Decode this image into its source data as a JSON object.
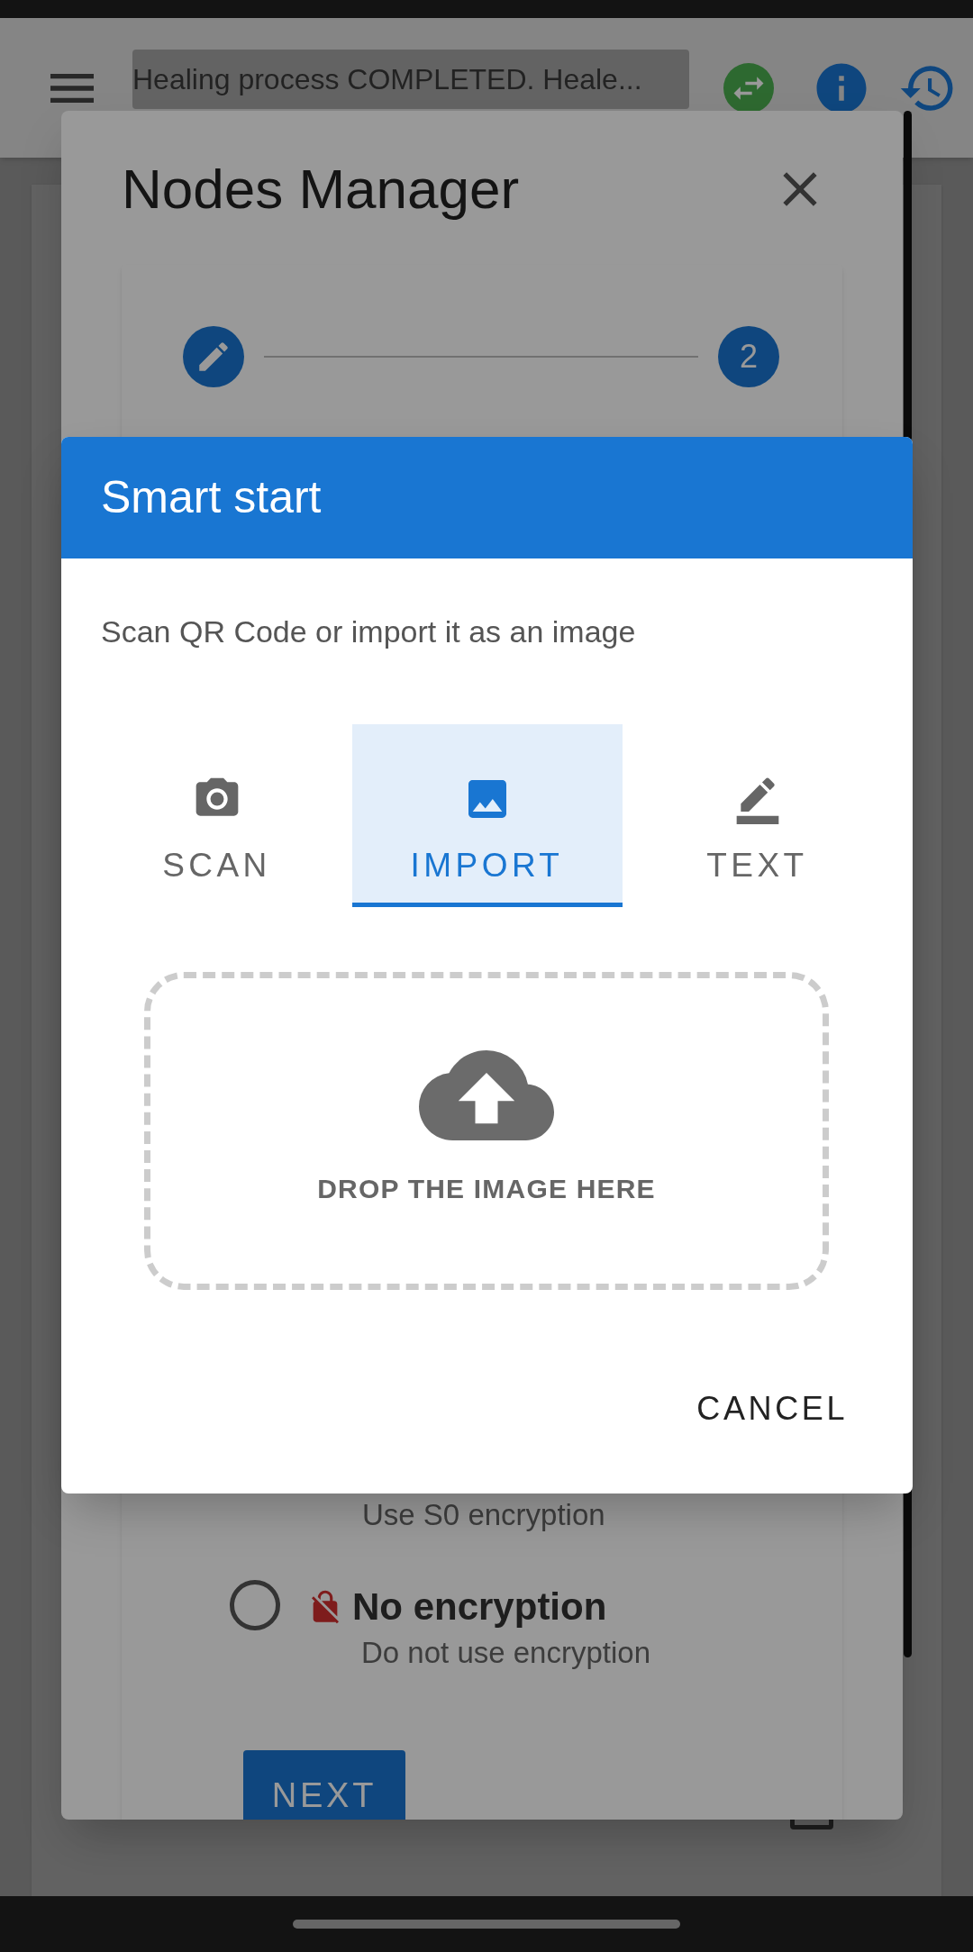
{
  "app_bar": {
    "status_text": "Healing process COMPLETED. Heale..."
  },
  "page": {
    "checkbox": {
      "checked": false
    }
  },
  "nodes_manager": {
    "title": "Nodes Manager",
    "steps": [
      {
        "kind": "edit"
      },
      {
        "kind": "number",
        "label": "2"
      }
    ],
    "security_options": [
      {
        "kind": "partial",
        "description": "Use S0 encryption"
      },
      {
        "kind": "full",
        "title": "No encryption",
        "description": "Do not use encryption",
        "selected": false
      }
    ],
    "next_button": "NEXT"
  },
  "smart_start": {
    "title": "Smart start",
    "instructions": "Scan QR Code or import it as an image",
    "tabs": [
      {
        "label": "SCAN",
        "kind": "camera",
        "selected": false
      },
      {
        "label": "IMPORT",
        "kind": "image",
        "selected": true
      },
      {
        "label": "TEXT",
        "kind": "pen",
        "selected": false
      }
    ],
    "dropzone": {
      "label": "DROP THE IMAGE HERE"
    },
    "buttons": [
      "CANCEL"
    ]
  }
}
